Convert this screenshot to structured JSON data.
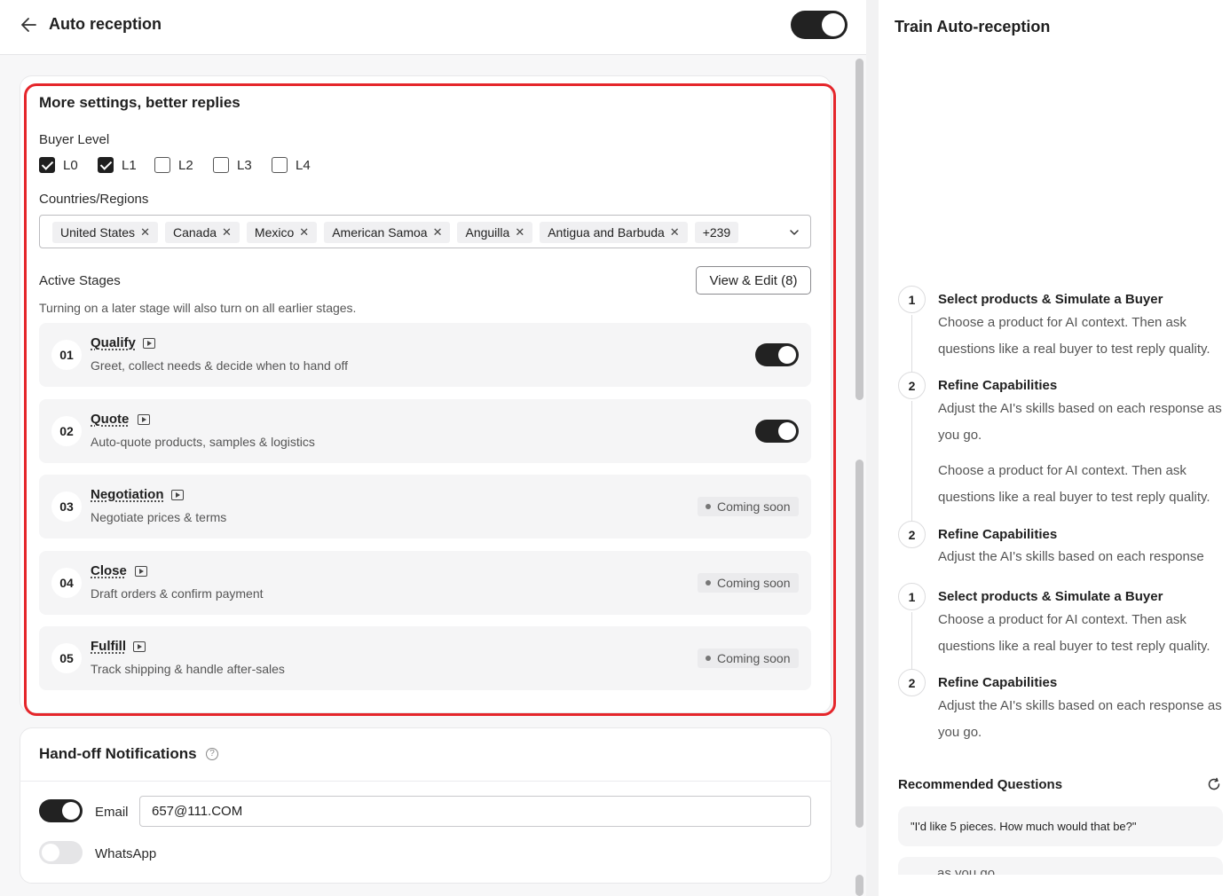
{
  "header": {
    "title": "Auto reception"
  },
  "settings": {
    "title": "More settings, better replies",
    "buyer_level_label": "Buyer Level",
    "levels": [
      {
        "label": "L0",
        "checked": true
      },
      {
        "label": "L1",
        "checked": true
      },
      {
        "label": "L2",
        "checked": false
      },
      {
        "label": "L3",
        "checked": false
      },
      {
        "label": "L4",
        "checked": false
      }
    ],
    "countries_label": "Countries/Regions",
    "countries": [
      "United States",
      "Canada",
      "Mexico",
      "American Samoa",
      "Anguilla",
      "Antigua and Barbuda"
    ],
    "countries_more": "+239",
    "active_stages_label": "Active Stages",
    "view_edit_label": "View & Edit (8)",
    "stages_hint": "Turning on a later stage will also turn on all earlier stages.",
    "stages": [
      {
        "num": "01",
        "name": "Qualify",
        "desc": "Greet, collect needs & decide when to hand off",
        "enabled": true
      },
      {
        "num": "02",
        "name": "Quote",
        "desc": "Auto-quote products, samples & logistics",
        "enabled": true
      },
      {
        "num": "03",
        "name": "Negotiation",
        "desc": "Negotiate prices & terms",
        "badge": "Coming soon"
      },
      {
        "num": "04",
        "name": "Close",
        "desc": "Draft orders & confirm payment",
        "badge": "Coming soon"
      },
      {
        "num": "05",
        "name": "Fulfill",
        "desc": "Track shipping & handle after-sales",
        "badge": "Coming soon"
      }
    ]
  },
  "handoff": {
    "title": "Hand-off Notifications",
    "email_label": "Email",
    "email_value": "657@111.COM",
    "whatsapp_label": "WhatsApp"
  },
  "train": {
    "title": "Train Auto-reception",
    "steps": [
      {
        "num": "1",
        "title": "Select products & Simulate a Buyer",
        "desc": "Choose a product for AI context. Then ask questions like a real buyer to test reply quality."
      },
      {
        "num": "2",
        "title": "Refine Capabilities",
        "desc": "Adjust the AI's skills based on each response as you go."
      },
      {
        "num": "",
        "title": "",
        "desc": "Choose a product for AI context. Then ask questions like a real buyer to test reply quality."
      },
      {
        "num": "2",
        "title": "Refine Capabilities",
        "desc": "Adjust the AI's skills based on each response"
      },
      {
        "num": "1",
        "title": "Select products & Simulate a Buyer",
        "desc": "Choose a product for AI context. Then ask questions like a real buyer to test reply quality."
      },
      {
        "num": "2",
        "title": "Refine Capabilities",
        "desc": "Adjust the AI's skills based on each response as you go."
      }
    ],
    "recommended_title": "Recommended Questions",
    "questions": [
      "\"I'd like 5 pieces. How much would that be?\""
    ],
    "partial_text": "as you go."
  }
}
